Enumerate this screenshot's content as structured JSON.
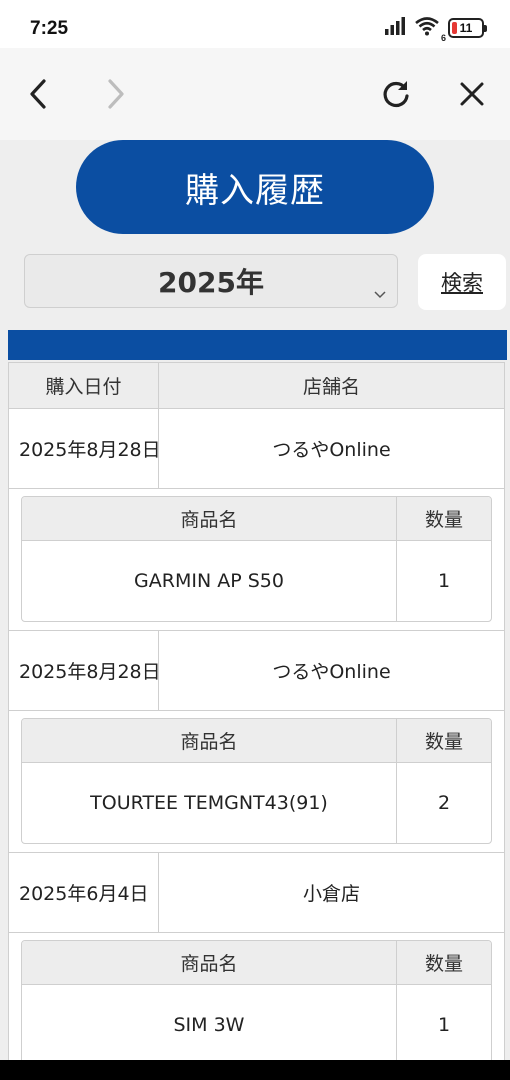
{
  "status_bar": {
    "time": "7:25",
    "battery_level": "11",
    "network": "6"
  },
  "browser_nav": {
    "back_icon": "chevron-left-icon",
    "forward_icon": "chevron-right-icon",
    "reload_icon": "reload-icon",
    "close_icon": "close-icon"
  },
  "page": {
    "title": "購入履歴",
    "year_select_value": "2025年",
    "search_label": "検索",
    "accent_color": "#0b4ea2"
  },
  "table": {
    "col_date": "購入日付",
    "col_store": "店舗名",
    "item_col_name": "商品名",
    "item_col_qty": "数量"
  },
  "orders": [
    {
      "date": "2025年8月28日",
      "store": "つるやOnline",
      "items": [
        {
          "name": "GARMIN AP S50",
          "qty": "1"
        }
      ]
    },
    {
      "date": "2025年8月28日",
      "store": "つるやOnline",
      "items": [
        {
          "name": "TOURTEE TEMGNT43(91)",
          "qty": "2"
        }
      ]
    },
    {
      "date": "2025年6月4日",
      "store": "小倉店",
      "items": [
        {
          "name": "SIM 3W",
          "qty": "1"
        }
      ]
    }
  ]
}
